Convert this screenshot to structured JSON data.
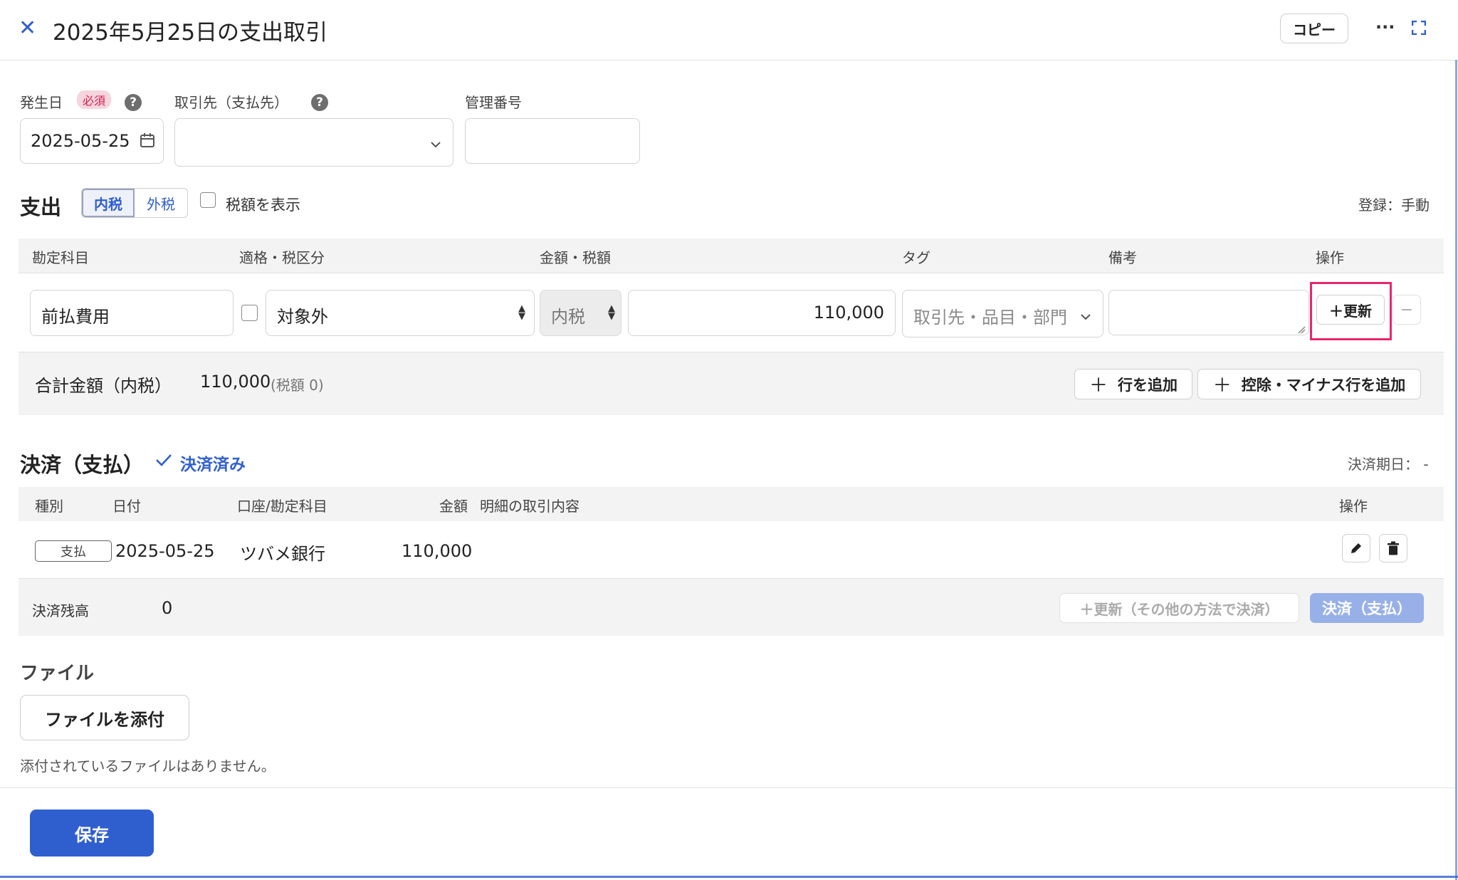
{
  "header": {
    "title": "2025年5月25日の支出取引",
    "copy_label": "コピー",
    "more_label": "···"
  },
  "form": {
    "date_label": "発生日",
    "required_badge": "必須",
    "date_value": "2025-05-25",
    "partner_label": "取引先（支払先）",
    "partner_value": "",
    "ref_label": "管理番号",
    "ref_value": ""
  },
  "expense": {
    "section_title": "支出",
    "tax_toggle": [
      "内税",
      "外税"
    ],
    "show_tax_label": "税額を表示",
    "registration": "登録：手動",
    "columns": [
      "勘定科目",
      "適格・税区分",
      "金額・税額",
      "タグ",
      "備考",
      "操作"
    ],
    "row": {
      "account": "前払費用",
      "tax_category": "対象外",
      "tax_mode": "内税",
      "amount": "110,000",
      "tags_placeholder": "取引先・品目・部門",
      "note": "",
      "update_label": "＋更新",
      "remove_label": "−"
    },
    "total_label": "合計金額（内税）",
    "total_value": "110,000",
    "total_tax": "(税額 0)",
    "add_row_label": "行を追加",
    "add_minus_row_label": "控除・マイナス行を追加"
  },
  "settlement": {
    "section_title": "決済（支払）",
    "status": "決済済み",
    "due_date": "決済期日： -",
    "columns": [
      "種別",
      "日付",
      "口座/勘定科目",
      "金額",
      "明細の取引内容",
      "操作"
    ],
    "row": {
      "type": "支払",
      "date": "2025-05-25",
      "account": "ツバメ銀行",
      "amount": "110,000",
      "detail": ""
    },
    "balance_label": "決済残高",
    "balance_value": "0",
    "other_method_label": "＋更新（その他の方法で決済）",
    "pay_label": "決済（支払）"
  },
  "files": {
    "section_title": "ファイル",
    "attach_label": "ファイルを添付",
    "empty_text": "添付されているファイルはありません。"
  },
  "footer": {
    "save_label": "保存"
  },
  "colors": {
    "accent_blue": "#2f5fcf",
    "highlight_pink": "#e8266d",
    "required_pink": "#f6d5de"
  }
}
